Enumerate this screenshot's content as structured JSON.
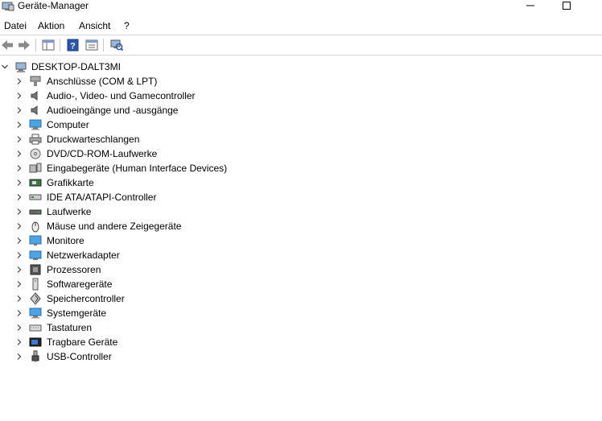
{
  "window": {
    "title": "Geräte-Manager"
  },
  "menu": [
    "Datei",
    "Aktion",
    "Ansicht",
    "?"
  ],
  "tree": {
    "root": "DESKTOP-DALT3MI",
    "categories": [
      {
        "label": "Anschlüsse (COM & LPT)",
        "icon": "port-icon"
      },
      {
        "label": "Audio-, Video- und Gamecontroller",
        "icon": "speaker-icon"
      },
      {
        "label": "Audioeingänge und -ausgänge",
        "icon": "speaker-icon"
      },
      {
        "label": "Computer",
        "icon": "computer-icon"
      },
      {
        "label": "Druckwarteschlangen",
        "icon": "printer-icon"
      },
      {
        "label": "DVD/CD-ROM-Laufwerke",
        "icon": "disc-icon"
      },
      {
        "label": "Eingabegeräte (Human Interface Devices)",
        "icon": "hid-icon"
      },
      {
        "label": "Grafikkarte",
        "icon": "graphics-card-icon"
      },
      {
        "label": "IDE ATA/ATAPI-Controller",
        "icon": "ide-controller-icon"
      },
      {
        "label": "Laufwerke",
        "icon": "drive-icon"
      },
      {
        "label": "Mäuse und andere Zeigegeräte",
        "icon": "mouse-icon"
      },
      {
        "label": "Monitore",
        "icon": "monitor-icon"
      },
      {
        "label": "Netzwerkadapter",
        "icon": "network-adapter-icon"
      },
      {
        "label": "Prozessoren",
        "icon": "processor-icon"
      },
      {
        "label": "Softwaregeräte",
        "icon": "software-device-icon"
      },
      {
        "label": "Speichercontroller",
        "icon": "storage-controller-icon"
      },
      {
        "label": "Systemgeräte",
        "icon": "system-device-icon"
      },
      {
        "label": "Tastaturen",
        "icon": "keyboard-icon"
      },
      {
        "label": "Tragbare Geräte",
        "icon": "portable-device-icon"
      },
      {
        "label": "USB-Controller",
        "icon": "usb-icon"
      }
    ]
  }
}
